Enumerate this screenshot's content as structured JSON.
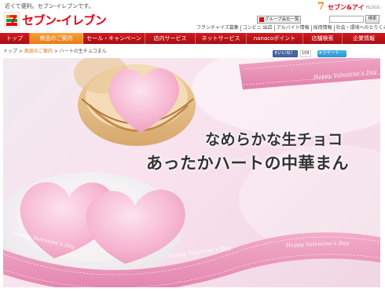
{
  "header": {
    "tagline": "近くて便利。セブン-イレブンです。",
    "logo_text": "セブン-イレブン",
    "group_button_label": "グループ会社一覧",
    "holdings_logo_text": "セブン&アイ",
    "holdings_sub": "HLDGS.",
    "search_button_label": "検索",
    "util_links": [
      "フランチャイズ募集",
      "コンビニ 出店",
      "アルバイト情報",
      "採用情報",
      "社会・環境へのとりくみ"
    ]
  },
  "gnav": {
    "items": [
      {
        "label": "トップ",
        "active": false
      },
      {
        "label": "商品のご案内",
        "active": true
      },
      {
        "label": "セール・キャンペーン",
        "active": false
      },
      {
        "label": "店内サービス",
        "active": false
      },
      {
        "label": "ネットサービス",
        "active": false
      },
      {
        "label": "nanacoポイント",
        "active": false
      },
      {
        "label": "店舗検索",
        "active": false
      },
      {
        "label": "企業情報",
        "active": false
      }
    ]
  },
  "breadcrumb": {
    "home": "トップ",
    "sep": " > ",
    "section": "商品のご案内",
    "current": "ハートの生チョコまん"
  },
  "social": {
    "fb_label": "いいね！",
    "fb_count": "109",
    "tw_label": "ツイート"
  },
  "hero": {
    "copy_line1": "なめらかな生チョコ",
    "copy_line2": "あったかハートの中華まん",
    "ribbon_text": "Happy Valentine's Day"
  },
  "colors": {
    "brand_red": "#cf1b20",
    "active_orange": "#f08a24",
    "pink_ribbon": "#e98fb6"
  }
}
